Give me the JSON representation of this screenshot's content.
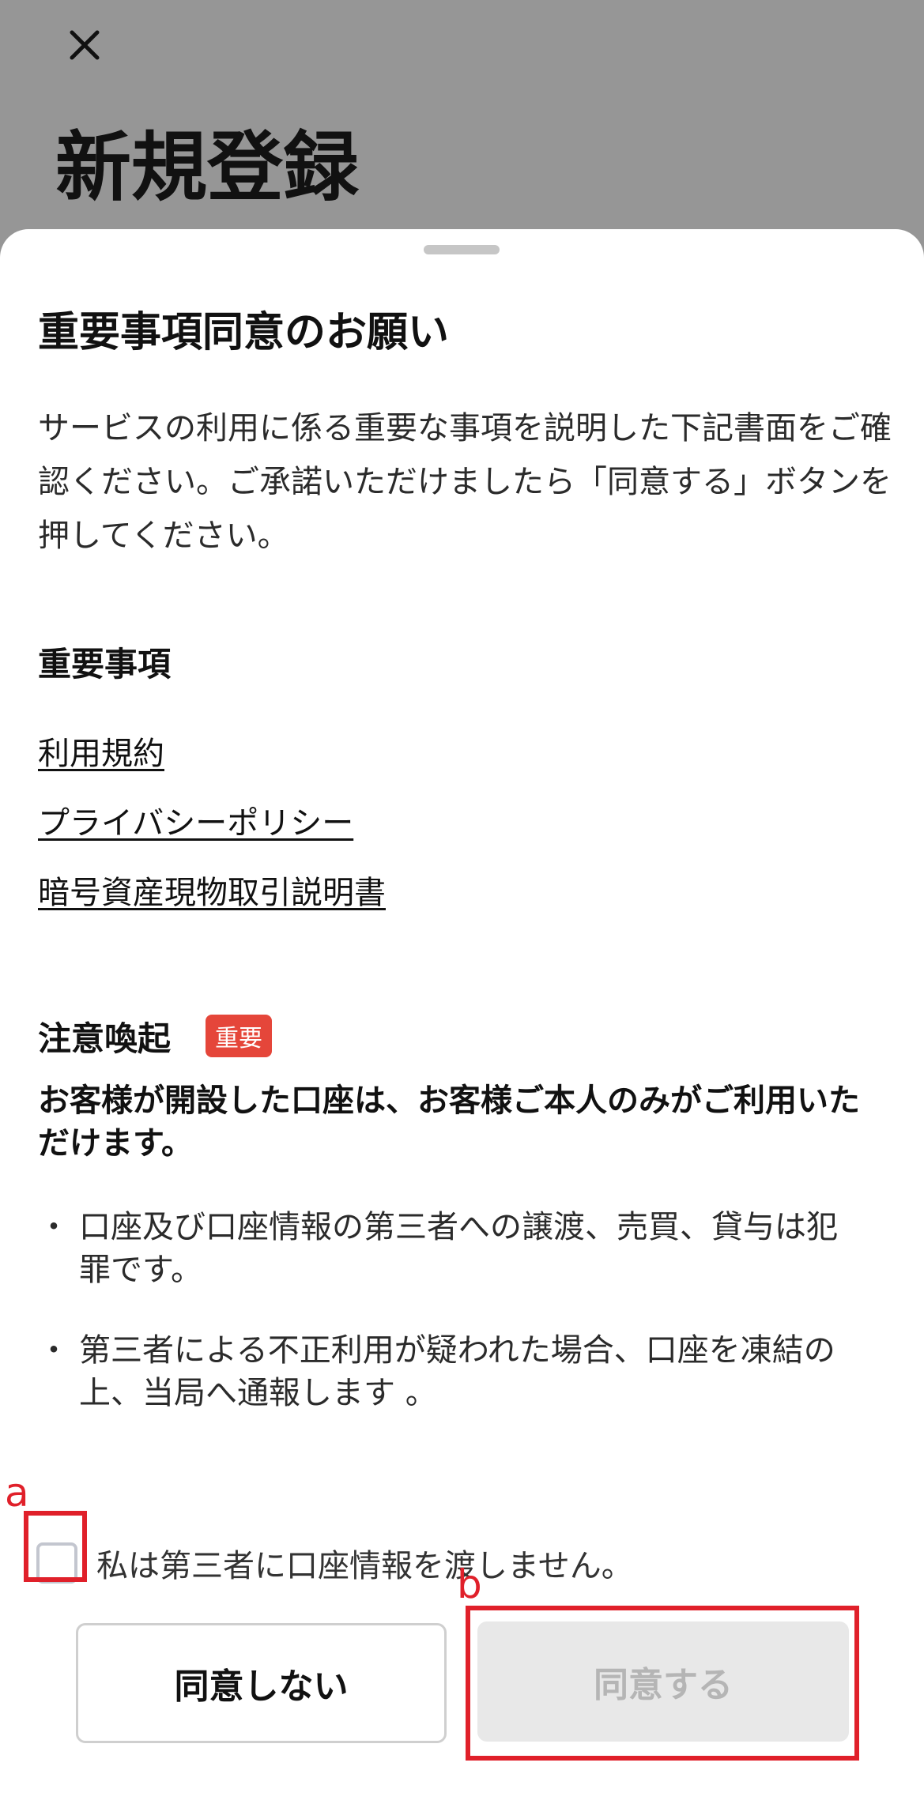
{
  "background_title": "新規登録",
  "sheet": {
    "heading": "重要事項同意のお願い",
    "intro": "サービスの利用に係る重要な事項を説明した下記書面をご確認ください。ご承諾いただけましたら「同意する」ボタンを押してください。",
    "documents": {
      "title": "重要事項",
      "links": [
        "利用規約",
        "プライバシーポリシー",
        "暗号資産現物取引説明書"
      ]
    },
    "warning": {
      "title": "注意喚起",
      "badge": "重要",
      "lead": "お客様が開設した口座は、お客様ご本人のみがご利用いただけます。",
      "bullets": [
        "口座及び口座情報の第三者への譲渡、売買、貸与は犯罪です。",
        "第三者による不正利用が疑われた場合、口座を凍結の上、当局へ通報します 。"
      ],
      "bullet_marker": "・"
    },
    "checkbox": {
      "label": "私は第三者に口座情報を渡しません。",
      "checked": false
    },
    "buttons": {
      "decline": "同意しない",
      "agree": "同意する",
      "agree_enabled": false
    }
  },
  "annotations": [
    "a",
    "b"
  ],
  "colors": {
    "backdrop": "#969696",
    "badge": "#e5463a",
    "annotation": "#e0202a",
    "disabled_button": "#e8e8e8",
    "disabled_text": "#b5b5b5"
  },
  "icons": {
    "close": "close-icon"
  }
}
